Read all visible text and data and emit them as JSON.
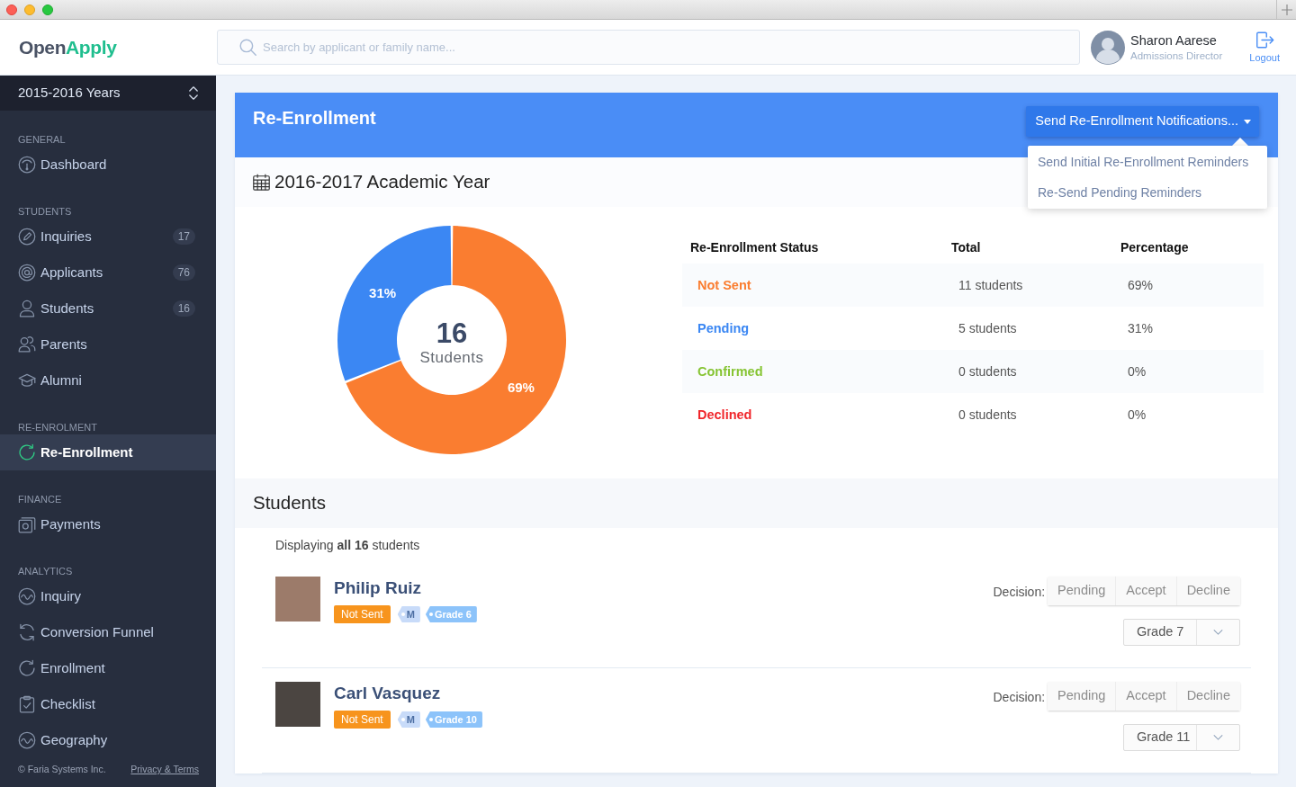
{
  "header": {
    "logo": {
      "first": "Open",
      "second": "Apply"
    },
    "search": {
      "placeholder": "Search by applicant or family name..."
    },
    "user": {
      "name": "Sharon Aarese",
      "role": "Admissions Director"
    },
    "logout": {
      "label": "Logout"
    }
  },
  "sidebar": {
    "year_selector": {
      "value": "2015-2016 Years"
    },
    "sections": [
      {
        "title": "GENERAL",
        "items": [
          {
            "label": "Dashboard",
            "selected": false
          }
        ]
      },
      {
        "title": "STUDENTS",
        "items": [
          {
            "label": "Inquiries",
            "badge": "17",
            "selected": false
          },
          {
            "label": "Applicants",
            "badge": "76",
            "selected": false
          },
          {
            "label": "Students",
            "badge": "16",
            "selected": false
          },
          {
            "label": "Parents",
            "selected": false
          },
          {
            "label": "Alumni",
            "selected": false
          }
        ]
      },
      {
        "title": "RE-ENROLMENT",
        "items": [
          {
            "label": "Re-Enrollment",
            "selected": true
          }
        ]
      },
      {
        "title": "FINANCE",
        "items": [
          {
            "label": "Payments",
            "selected": false
          }
        ]
      },
      {
        "title": "ANALYTICS",
        "items": [
          {
            "label": "Inquiry",
            "selected": false
          },
          {
            "label": "Conversion Funnel",
            "selected": false
          },
          {
            "label": "Enrollment",
            "selected": false
          },
          {
            "label": "Checklist",
            "selected": false
          },
          {
            "label": "Geography",
            "selected": false
          }
        ]
      }
    ],
    "footer": {
      "copyright": "© Faria Systems Inc.",
      "link": "Privacy & Terms"
    }
  },
  "page": {
    "title": "Re-Enrollment",
    "notify_button": {
      "label": "Send Re-Enrollment Notifications...",
      "expanded": true
    },
    "menu": [
      {
        "label": "Send Initial Re-Enrollment Reminders"
      },
      {
        "label": "Re-Send Pending Reminders"
      }
    ]
  },
  "overview": {
    "heading": "2016-2017 Academic Year",
    "chart": {
      "center_value": "16",
      "center_label": "Students",
      "chart_data": {
        "type": "donut",
        "values": [
          69,
          31
        ],
        "value_labels": [
          "69%",
          "31%"
        ]
      }
    },
    "table": {
      "columns": [
        "Re-Enrollment Status",
        "Total",
        "Percentage"
      ],
      "rows": [
        {
          "status": "Not Sent",
          "color": "#fa7d30",
          "total": "11 students",
          "percentage": "69%"
        },
        {
          "status": "Pending",
          "color": "#3b87f3",
          "total": "5 students",
          "percentage": "31%"
        },
        {
          "status": "Confirmed",
          "color": "#86c433",
          "total": "0 students",
          "percentage": "0%"
        },
        {
          "status": "Declined",
          "color": "#f0262b",
          "total": "0 students",
          "percentage": "0%"
        }
      ]
    }
  },
  "students": {
    "title": "Students",
    "summary": "Displaying **all 16** students",
    "items": [
      {
        "name": "Philip Ruiz",
        "status": "Not Sent",
        "tags": [
          {
            "text": "M",
            "color": "#c8dbf9"
          },
          {
            "text": "Grade 6",
            "color": "#8cc3fa"
          }
        ],
        "decision_label": "Decision:",
        "decisions": [
          {
            "label": "Pending",
            "selected": false
          },
          {
            "label": "Accept",
            "selected": false
          },
          {
            "label": "Decline",
            "selected": false
          }
        ],
        "grade_select": {
          "value": "Grade 7"
        }
      },
      {
        "name": "Carl Vasquez",
        "status": "Not Sent",
        "tags": [
          {
            "text": "M",
            "color": "#c8dbf9"
          },
          {
            "text": "Grade 10",
            "color": "#8cc3fa"
          }
        ],
        "decision_label": "Decision:",
        "decisions": [
          {
            "label": "Pending",
            "selected": false
          },
          {
            "label": "Accept",
            "selected": false
          },
          {
            "label": "Decline",
            "selected": false
          }
        ],
        "grade_select": {
          "value": "Grade 11"
        }
      }
    ]
  }
}
